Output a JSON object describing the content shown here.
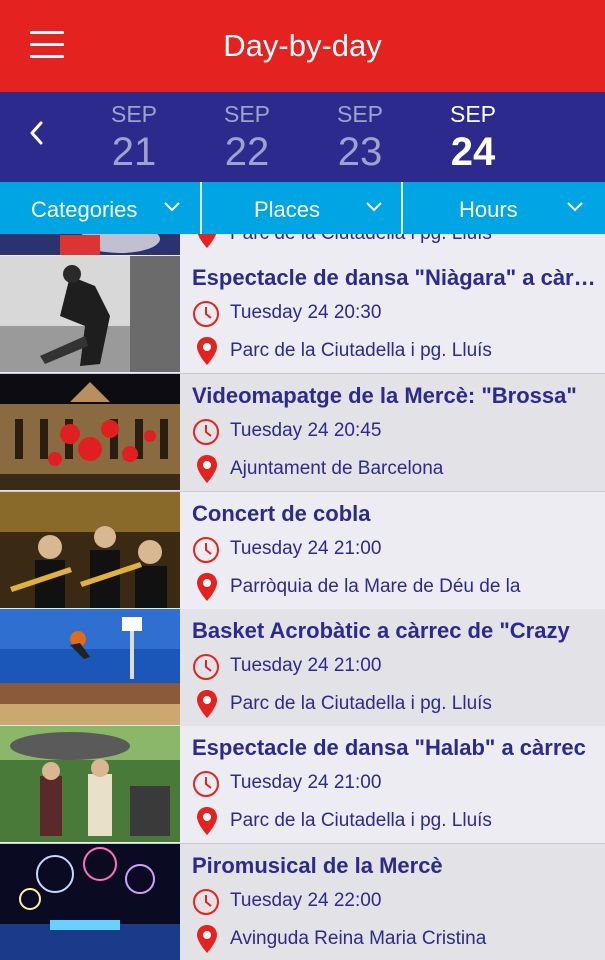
{
  "app": {
    "title": "Day-by-day"
  },
  "dates": [
    {
      "month": "SEP",
      "day": "21"
    },
    {
      "month": "SEP",
      "day": "22"
    },
    {
      "month": "SEP",
      "day": "23"
    },
    {
      "month": "SEP",
      "day": "24",
      "active": true
    }
  ],
  "filters": [
    {
      "label": "Categories"
    },
    {
      "label": "Places"
    },
    {
      "label": "Hours"
    }
  ],
  "events": [
    {
      "title": "",
      "time": "",
      "place": "Parc de la Ciutadella i pg. Lluís"
    },
    {
      "title": "Espectacle de dansa \"Niàgara\" a càrrec",
      "time": "Tuesday 24 20:30",
      "place": "Parc de la Ciutadella i pg. Lluís"
    },
    {
      "title": "Videomapatge de la Mercè: \"Brossa\"",
      "time": "Tuesday 24 20:45",
      "place": "Ajuntament de Barcelona"
    },
    {
      "title": "Concert de cobla",
      "time": "Tuesday 24 21:00",
      "place": "Parròquia de la Mare de Déu de la"
    },
    {
      "title": "Basket Acrobàtic a càrrec de \"Crazy",
      "time": "Tuesday 24 21:00",
      "place": "Parc de la Ciutadella i pg. Lluís"
    },
    {
      "title": "Espectacle de dansa \"Halab\" a càrrec",
      "time": "Tuesday 24 21:00",
      "place": "Parc de la Ciutadella i pg. Lluís"
    },
    {
      "title": "Piromusical de la Mercè",
      "time": "Tuesday 24 22:00",
      "place": "Avinguda Reina Maria Cristina"
    }
  ],
  "icons": {
    "menu": "hamburger-icon",
    "back": "chevron-left-icon",
    "clock": "clock-icon",
    "pin": "map-pin-icon",
    "dropdown": "chevron-down-icon"
  },
  "colors": {
    "appbar": "#e42320",
    "datebar": "#2c2a8c",
    "filterbar": "#02a5e3",
    "text_primary": "#2c2a8c",
    "icon_red": "#e42320"
  }
}
